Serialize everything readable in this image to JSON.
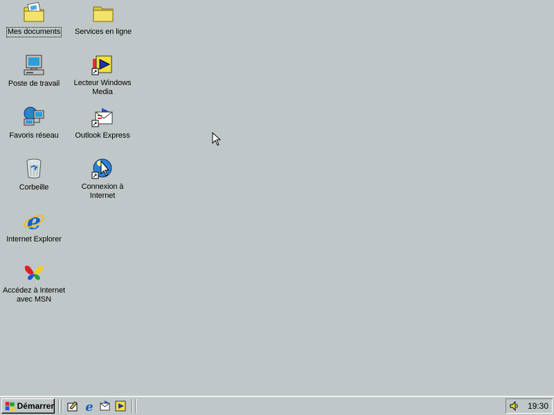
{
  "desktop": {
    "icons": [
      {
        "label": "Mes documents",
        "icon": "my-documents-folder-icon"
      },
      {
        "label": "Services en ligne",
        "icon": "folder-icon"
      },
      {
        "label": "Poste de travail",
        "icon": "my-computer-icon"
      },
      {
        "label": "Lecteur Windows\nMedia",
        "icon": "windows-media-player-icon"
      },
      {
        "label": "Favoris réseau",
        "icon": "network-places-icon"
      },
      {
        "label": "Outlook Express",
        "icon": "outlook-express-icon"
      },
      {
        "label": "Corbeille",
        "icon": "recycle-bin-icon"
      },
      {
        "label": "Connexion à\nInternet",
        "icon": "connect-internet-icon"
      },
      {
        "label": "Internet Explorer",
        "icon": "internet-explorer-icon"
      },
      {
        "label": "Accédez à Internet\navec MSN",
        "icon": "msn-butterfly-icon"
      }
    ],
    "background_color": "#c0c7c8"
  },
  "taskbar": {
    "start_label": "Démarrer",
    "quick_launch": [
      {
        "icon": "show-desktop-icon"
      },
      {
        "icon": "internet-explorer-icon"
      },
      {
        "icon": "outlook-express-icon"
      },
      {
        "icon": "windows-media-player-icon"
      }
    ],
    "clock": "19:30",
    "tray_icon": "volume-icon"
  }
}
